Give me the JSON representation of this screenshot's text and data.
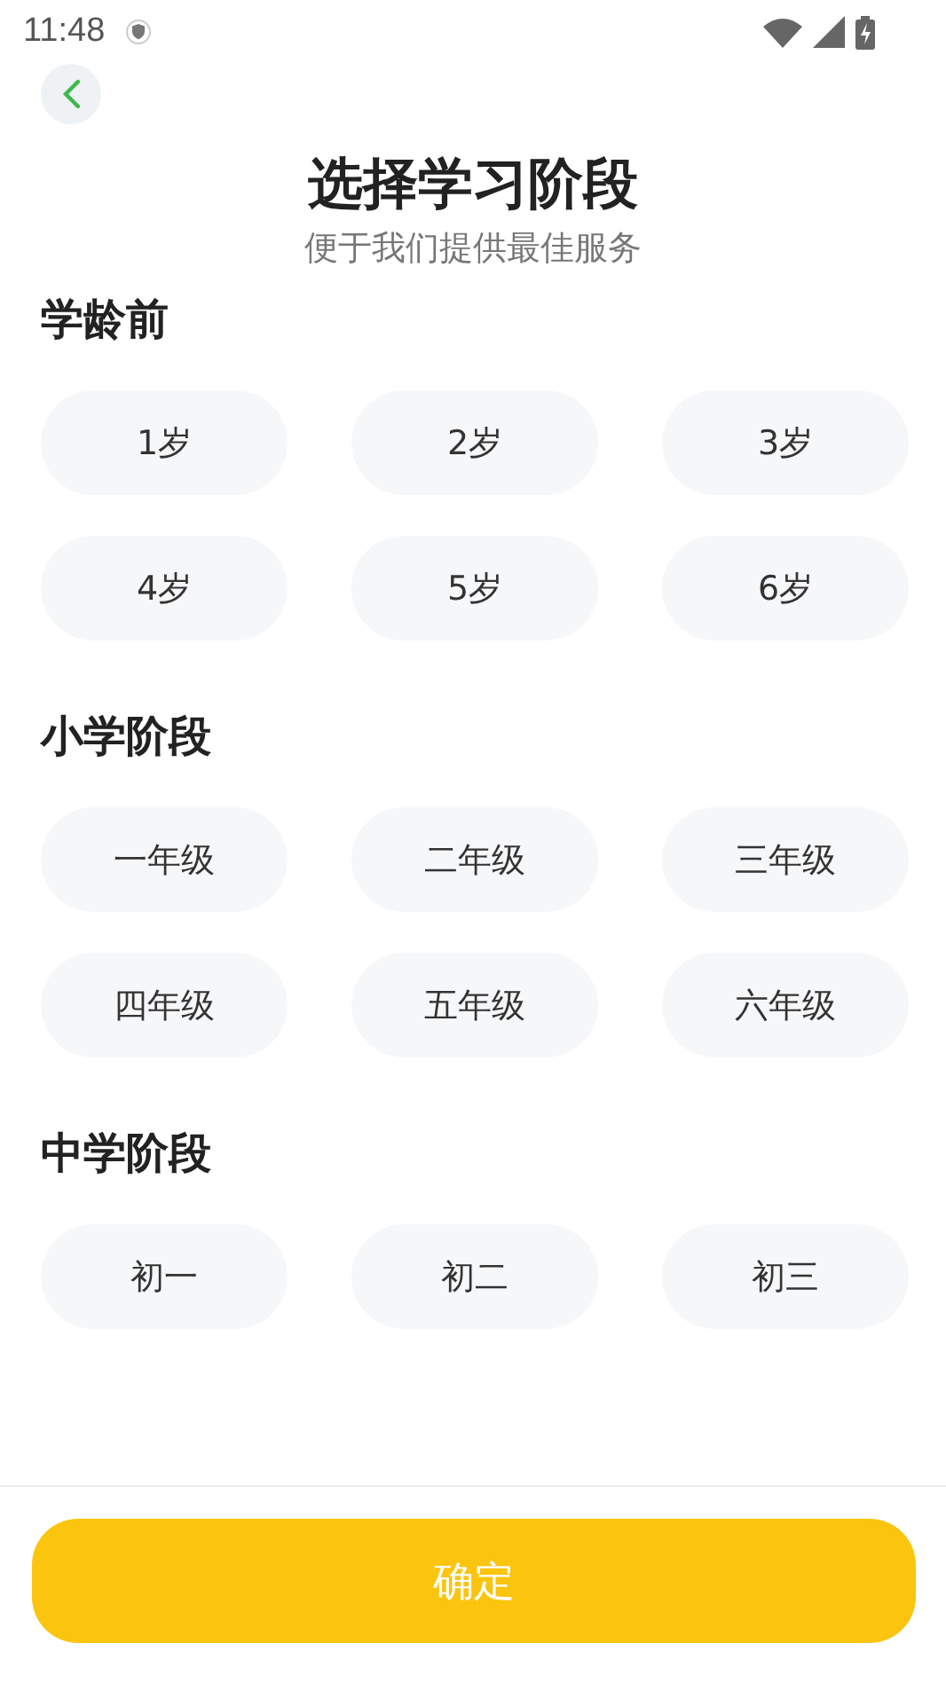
{
  "status_bar": {
    "time": "11:48"
  },
  "header": {
    "title": "选择学习阶段",
    "subtitle": "便于我们提供最佳服务"
  },
  "sections": [
    {
      "title": "学龄前",
      "options": [
        {
          "label": "1岁",
          "selected": false
        },
        {
          "label": "2岁",
          "selected": false
        },
        {
          "label": "3岁",
          "selected": false
        },
        {
          "label": "4岁",
          "selected": false
        },
        {
          "label": "5岁",
          "selected": false
        },
        {
          "label": "6岁",
          "selected": false
        }
      ]
    },
    {
      "title": "小学阶段",
      "options": [
        {
          "label": "一年级",
          "selected": false
        },
        {
          "label": "二年级",
          "selected": false
        },
        {
          "label": "三年级",
          "selected": false
        },
        {
          "label": "四年级",
          "selected": false
        },
        {
          "label": "五年级",
          "selected": false
        },
        {
          "label": "六年级",
          "selected": false
        }
      ]
    },
    {
      "title": "中学阶段",
      "options": [
        {
          "label": "初一",
          "selected": false
        },
        {
          "label": "初二",
          "selected": false
        },
        {
          "label": "初三",
          "selected": false
        }
      ]
    }
  ],
  "confirm_button": "确定"
}
